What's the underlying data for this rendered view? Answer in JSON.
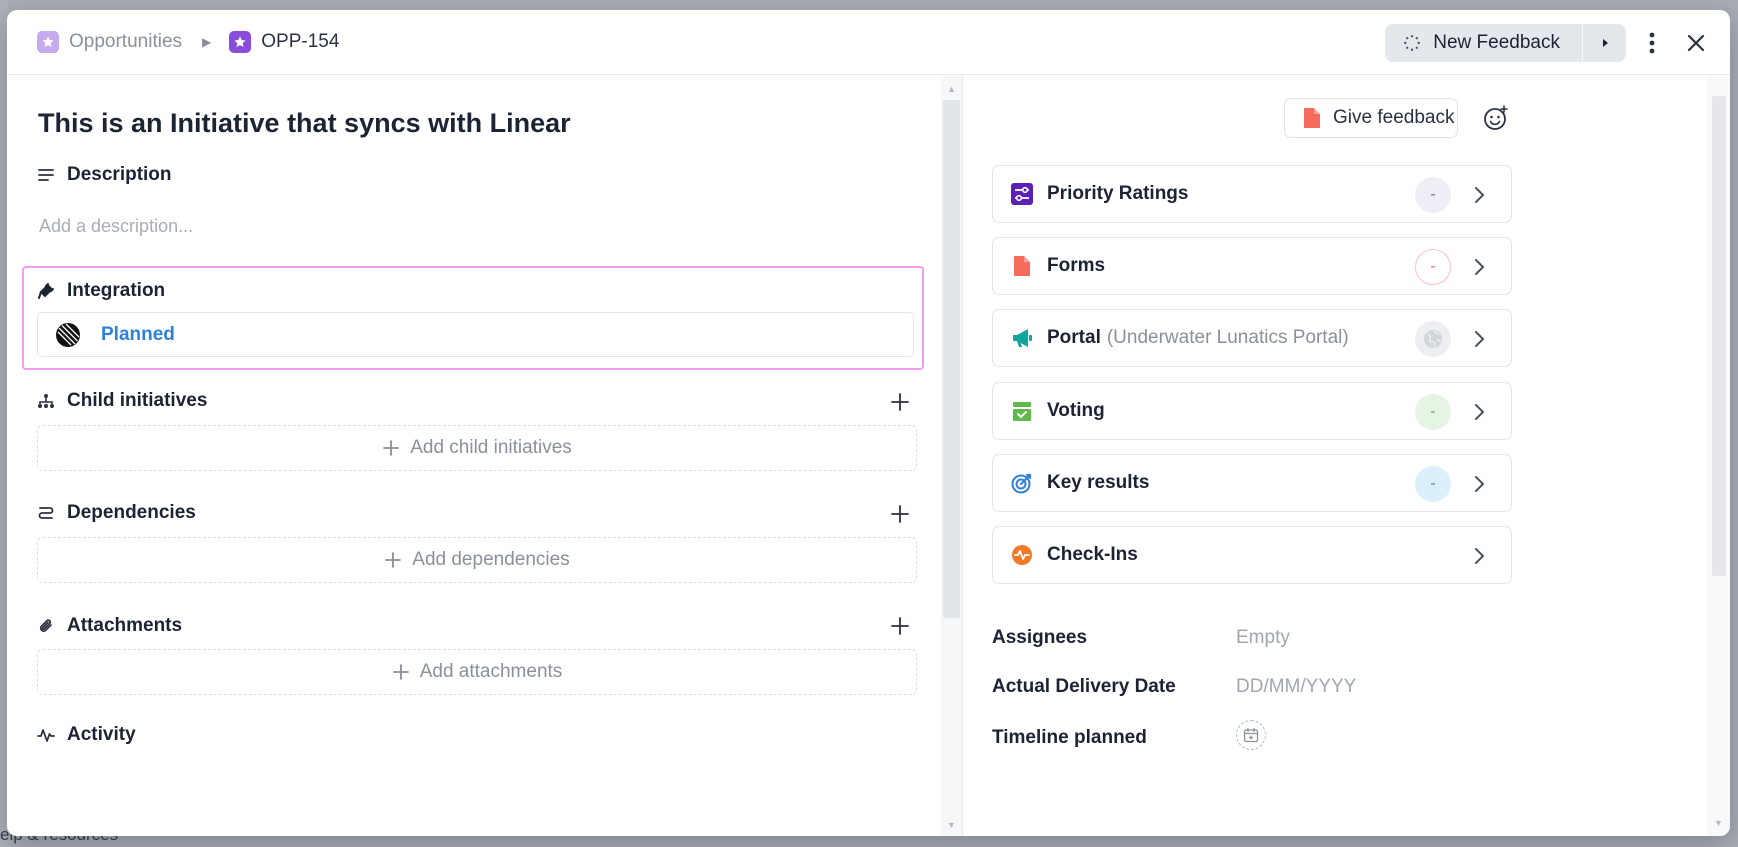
{
  "background": {
    "footer_text": "elp & resources"
  },
  "header": {
    "crumb_first": "Opportunities",
    "crumb_second": "OPP-154",
    "new_feedback_label": "New Feedback"
  },
  "main": {
    "title": "This is an Initiative that syncs with Linear",
    "description_label": "Description",
    "description_placeholder": "Add a description...",
    "integration_label": "Integration",
    "integration_status": "Planned",
    "child_initiatives_label": "Child initiatives",
    "add_child_initiatives": "Add child initiatives",
    "dependencies_label": "Dependencies",
    "add_dependencies": "Add dependencies",
    "attachments_label": "Attachments",
    "add_attachments": "Add attachments",
    "activity_label": "Activity"
  },
  "sidebar": {
    "give_feedback_label": "Give feedback",
    "cards": [
      {
        "label": "Priority Ratings",
        "sub": "",
        "badge": "-",
        "icon": "sliders-icon",
        "color": "#5b21b6",
        "badge_bg": "#efedf5",
        "badge_fg": "#6b7280"
      },
      {
        "label": "Forms",
        "sub": "",
        "badge": "-",
        "icon": "document-icon",
        "color": "#f56b5c",
        "badge_bg": "#ffffff",
        "badge_fg": "#f56b5c"
      },
      {
        "label": "Portal",
        "sub": "(Underwater Lunatics Portal)",
        "badge": "",
        "icon": "megaphone-icon",
        "color": "#0fa59c",
        "badge_bg": "#eceef1",
        "badge_fg": "#c5c9d0"
      },
      {
        "label": "Voting",
        "sub": "",
        "badge": "-",
        "icon": "ballot-box-icon",
        "color": "#5fb84a",
        "badge_bg": "#e6f4e4",
        "badge_fg": "#6aa85e"
      },
      {
        "label": "Key results",
        "sub": "",
        "badge": "-",
        "icon": "target-icon",
        "color": "#2f80d8",
        "badge_bg": "#dcf0fb",
        "badge_fg": "#3b8fd0"
      },
      {
        "label": "Check-Ins",
        "sub": "",
        "badge": "",
        "icon": "pulse-icon",
        "color": "#f07a2a",
        "badge_bg": "",
        "badge_fg": ""
      }
    ],
    "fields": {
      "assignees_label": "Assignees",
      "assignees_value": "Empty",
      "delivery_label": "Actual Delivery Date",
      "delivery_value": "DD/MM/YYYY",
      "timeline_label": "Timeline planned"
    }
  }
}
